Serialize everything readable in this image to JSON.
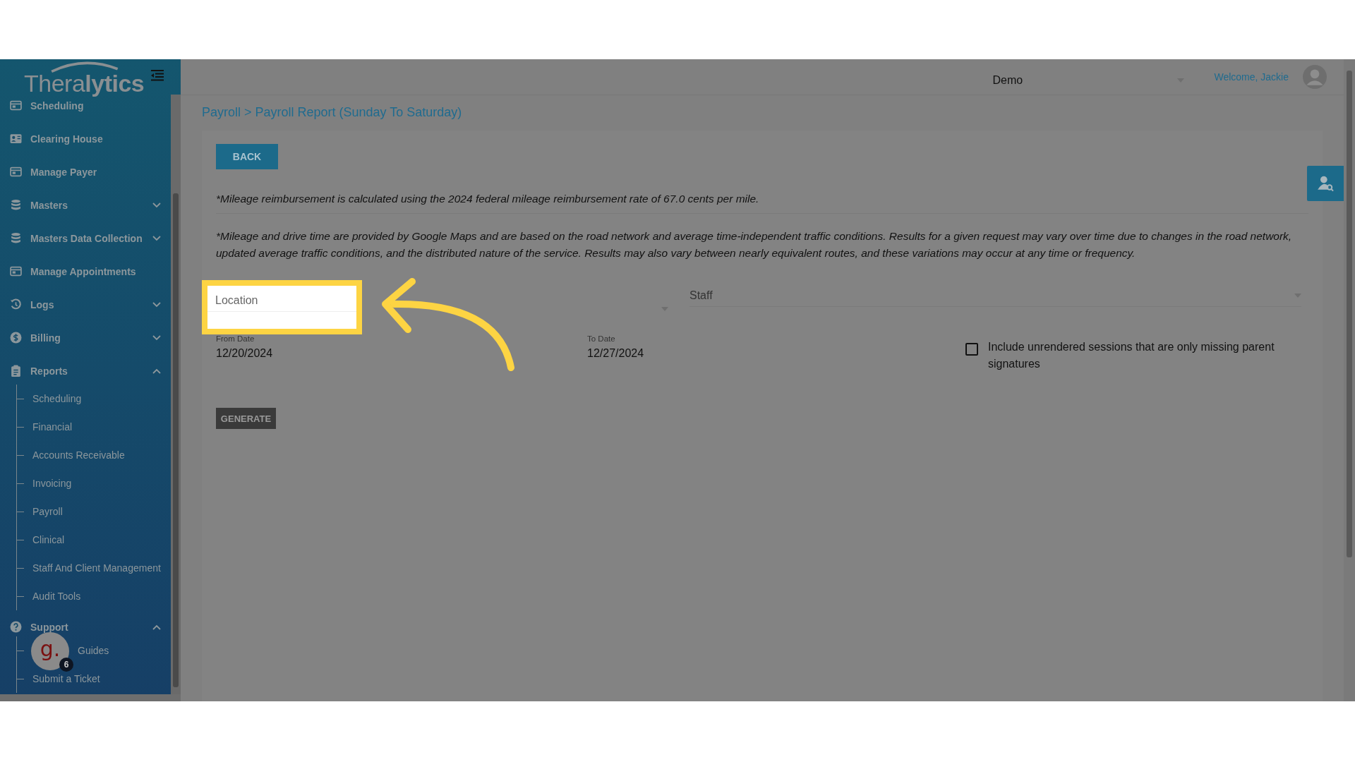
{
  "logo": {
    "light": "Thera",
    "bold": "lytics"
  },
  "sidebar": {
    "items": [
      {
        "label": "Scheduling",
        "kind": "link"
      },
      {
        "label": "Clearing House",
        "kind": "link"
      },
      {
        "label": "Manage Payer",
        "kind": "link"
      },
      {
        "label": "Masters",
        "kind": "group",
        "expanded": false
      },
      {
        "label": "Masters Data Collection",
        "kind": "group",
        "expanded": false
      },
      {
        "label": "Manage Appointments",
        "kind": "link"
      },
      {
        "label": "Logs",
        "kind": "group",
        "expanded": false
      },
      {
        "label": "Billing",
        "kind": "group",
        "expanded": false
      },
      {
        "label": "Reports",
        "kind": "group",
        "expanded": true,
        "children": [
          "Scheduling",
          "Financial",
          "Accounts Receivable",
          "Invoicing",
          "Payroll",
          "Clinical",
          "Staff And Client Management",
          "Audit Tools"
        ]
      },
      {
        "label": "Support",
        "kind": "group",
        "expanded": true,
        "children": [
          "Guides",
          "Submit a Ticket"
        ]
      }
    ]
  },
  "guide_widget": {
    "logo": "g.",
    "badge": "6"
  },
  "header": {
    "organization": "Demo",
    "welcome": "Welcome, Jackie"
  },
  "breadcrumb": "Payroll > Payroll Report (Sunday To Saturday)",
  "back_button": "BACK",
  "notes": [
    "*Mileage reimbursement is calculated using the 2024 federal mileage reimbursement rate of 67.0 cents per mile.",
    "*Mileage and drive time are provided by Google Maps and are based on the road network and average time-independent traffic conditions. Results for a given request may vary over time due to changes in the road network, updated average traffic conditions, and the distributed nature of the service. Results may also vary between nearly equivalent routes, and these variations may occur at any time or frequency."
  ],
  "location": {
    "placeholder": "Location"
  },
  "staff": {
    "placeholder": "Staff"
  },
  "from_date": {
    "label": "From Date",
    "value": "12/20/2024"
  },
  "to_date": {
    "label": "To Date",
    "value": "12/27/2024"
  },
  "include_unrendered": {
    "label": "Include unrendered sessions that are only missing parent signatures",
    "checked": false
  },
  "generate_button": "GENERATE"
}
